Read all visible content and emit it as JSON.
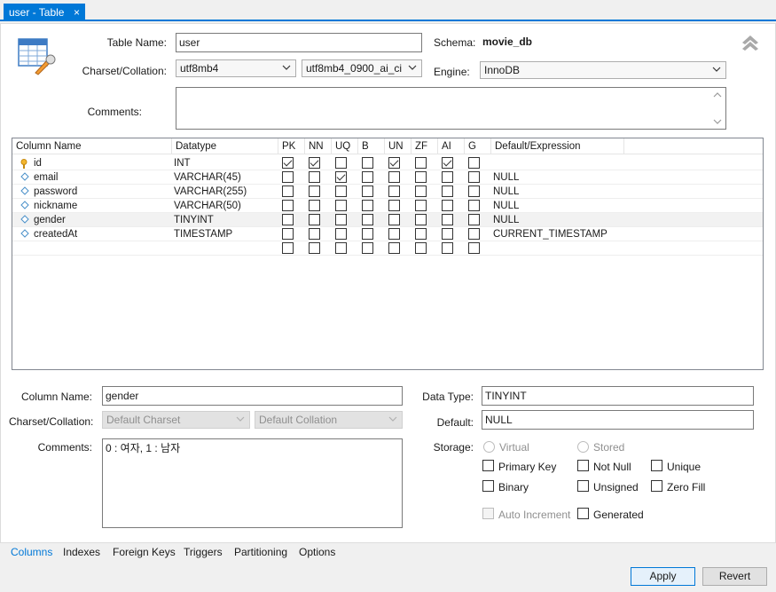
{
  "tab": {
    "title": "user - Table",
    "close": "×"
  },
  "table": {
    "name_label": "Table Name:",
    "name_value": "user",
    "schema_label": "Schema:",
    "schema_value": "movie_db",
    "charset_label": "Charset/Collation:",
    "charset_value": "utf8mb4",
    "collation_value": "utf8mb4_0900_ai_ci",
    "engine_label": "Engine:",
    "engine_value": "InnoDB",
    "comments_label": "Comments:",
    "comments_value": ""
  },
  "grid": {
    "headers": [
      "Column Name",
      "Datatype",
      "PK",
      "NN",
      "UQ",
      "B",
      "UN",
      "ZF",
      "AI",
      "G",
      "Default/Expression"
    ],
    "rows": [
      {
        "name": "id",
        "type": "INT",
        "default": "",
        "pk": true,
        "flags": [
          true,
          true,
          false,
          false,
          true,
          false,
          true,
          false
        ]
      },
      {
        "name": "email",
        "type": "VARCHAR(45)",
        "default": "NULL",
        "pk": false,
        "flags": [
          false,
          false,
          true,
          false,
          false,
          false,
          false,
          false
        ]
      },
      {
        "name": "password",
        "type": "VARCHAR(255)",
        "default": "NULL",
        "pk": false,
        "flags": [
          false,
          false,
          false,
          false,
          false,
          false,
          false,
          false
        ]
      },
      {
        "name": "nickname",
        "type": "VARCHAR(50)",
        "default": "NULL",
        "pk": false,
        "flags": [
          false,
          false,
          false,
          false,
          false,
          false,
          false,
          false
        ]
      },
      {
        "name": "gender",
        "type": "TINYINT",
        "default": "NULL",
        "pk": false,
        "flags": [
          false,
          false,
          false,
          false,
          false,
          false,
          false,
          false
        ]
      },
      {
        "name": "createdAt",
        "type": "TIMESTAMP",
        "default": "CURRENT_TIMESTAMP",
        "pk": false,
        "flags": [
          false,
          false,
          false,
          false,
          false,
          false,
          false,
          false
        ]
      }
    ]
  },
  "detail": {
    "column_name_label": "Column Name:",
    "column_name_value": "gender",
    "charset_label": "Charset/Collation:",
    "charset_placeholder": "Default Charset",
    "collation_placeholder": "Default Collation",
    "comments_label": "Comments:",
    "comments_value": "0 : 여자, 1 : 남자",
    "datatype_label": "Data Type:",
    "datatype_value": "TINYINT",
    "default_label": "Default:",
    "default_value": "NULL",
    "storage_label": "Storage:",
    "virtual": "Virtual",
    "stored": "Stored",
    "primary_key": "Primary Key",
    "not_null": "Not Null",
    "unique": "Unique",
    "binary": "Binary",
    "unsigned": "Unsigned",
    "zero_fill": "Zero Fill",
    "auto_increment": "Auto Increment",
    "generated": "Generated"
  },
  "bottom_tabs": [
    "Columns",
    "Indexes",
    "Foreign Keys",
    "Triggers",
    "Partitioning",
    "Options"
  ],
  "buttons": {
    "apply": "Apply",
    "revert": "Revert"
  },
  "colors": {
    "accent": "#0078d7",
    "selected_row": "#f2f2f2"
  }
}
